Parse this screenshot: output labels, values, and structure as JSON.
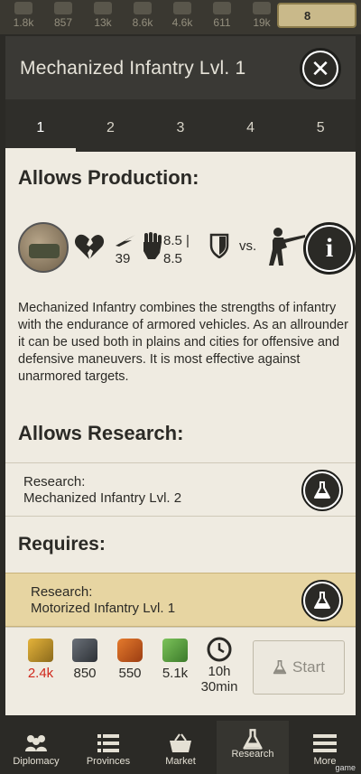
{
  "resources_top": [
    {
      "icon": "corn-icon",
      "value": "1.8k"
    },
    {
      "icon": "steel-icon",
      "value": "857"
    },
    {
      "icon": "oil-icon",
      "value": "13k"
    },
    {
      "icon": "beam-icon",
      "value": "8.6k"
    },
    {
      "icon": "ammo-icon",
      "value": "4.6k"
    },
    {
      "icon": "rare-icon",
      "value": "611"
    },
    {
      "icon": "money-icon",
      "value": "19k"
    }
  ],
  "gold": {
    "value": "8"
  },
  "modal": {
    "title": "Mechanized Infantry Lvl. 1",
    "tabs": [
      "1",
      "2",
      "3",
      "4",
      "5"
    ],
    "active_tab": "1",
    "allows_production": {
      "heading": "Allows Production:",
      "speed": "39",
      "attack": "8.5 |",
      "attack2": "8.5",
      "vs_label": "vs.",
      "description": "Mechanized Infantry combines the strengths of infantry with the endurance of armored vehicles. As an allrounder it can be used both in plains and cities for offensive and defensive maneuvers. It is most effective against unarmored targets."
    },
    "allows_research": {
      "heading": "Allows Research:",
      "item_label_1": "Research:",
      "item_label_2": "Mechanized Infantry Lvl. 2"
    },
    "requires": {
      "heading": "Requires:",
      "item_label_1": "Research:",
      "item_label_2": "Motorized Infantry Lvl. 1"
    },
    "costs": [
      {
        "icon": "corn-icon",
        "value": "2.4k",
        "color": "#d0281c"
      },
      {
        "icon": "steel-icon",
        "value": "850",
        "color": "#2b2a26"
      },
      {
        "icon": "oil-barrel-icon",
        "value": "550",
        "color": "#2b2a26"
      },
      {
        "icon": "money-icon",
        "value": "5.1k",
        "color": "#2b2a26"
      },
      {
        "icon": "clock-icon",
        "value": "10h",
        "value2": "30min",
        "color": "#2b2a26"
      }
    ],
    "start_label": "Start"
  },
  "bottom_nav": [
    {
      "label": "Diplomacy",
      "icon": "diplomacy-icon"
    },
    {
      "label": "Provinces",
      "icon": "provinces-icon"
    },
    {
      "label": "Market",
      "icon": "market-icon"
    },
    {
      "label": "Research",
      "icon": "research-icon"
    },
    {
      "label": "More",
      "icon": "more-icon"
    }
  ],
  "watermark": "game",
  "colors": {
    "accent_gold": "#e7d5a2",
    "cost_deficit": "#d0281c"
  }
}
